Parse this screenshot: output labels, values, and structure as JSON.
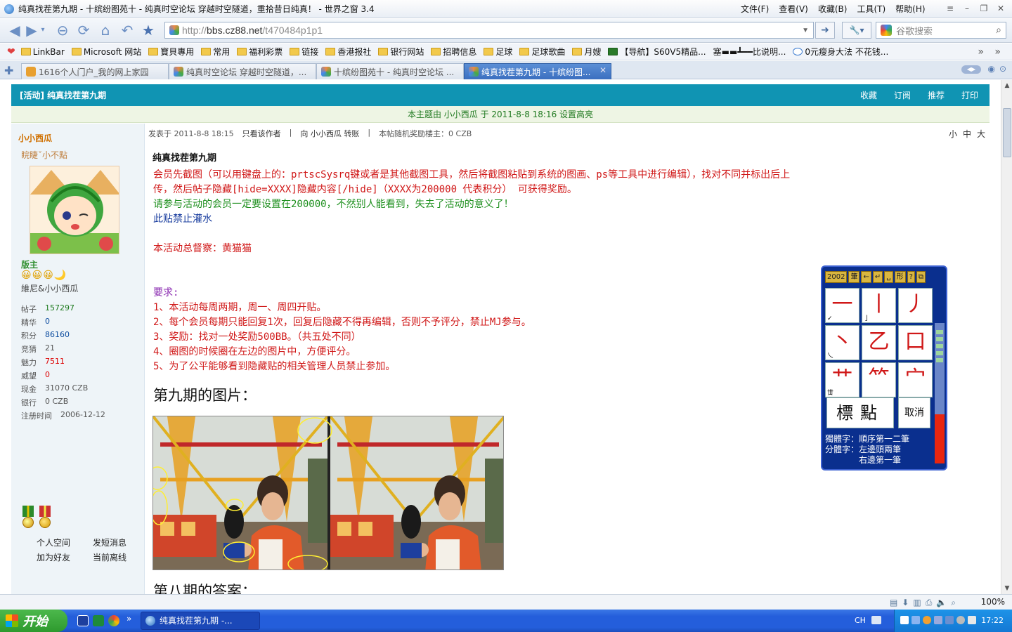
{
  "window": {
    "title": "纯真找茬第九期 - 十缤纷图苑十 - 纯真时空论坛 穿越时空隧道，重拾昔日纯真！ - 世界之窗 3.4",
    "menus": [
      "文件(F)",
      "查看(V)",
      "收藏(B)",
      "工具(T)",
      "帮助(H)"
    ]
  },
  "address": {
    "prefix": "http://",
    "host": "bbs.cz88.net",
    "path": "/t470484p1p1"
  },
  "search": {
    "placeholder": "谷歌搜索"
  },
  "bookmarks": [
    "LinkBar",
    "Microsoft 网站",
    "寶貝專用",
    "常用",
    "福利彩票",
    "链接",
    "香港报社",
    "银行网站",
    "招聘信息",
    "足球",
    "足球歌曲",
    "月嫂",
    "【导航】S60V5精品...",
    "塞▬▬┻━━比说明...",
    "0元瘦身大法 不花钱..."
  ],
  "tabs": [
    "1616个人门户_我的网上家园",
    "纯真时空论坛 穿越时空隧道，...",
    "十缤纷图苑十 - 纯真时空论坛 ...",
    "纯真找茬第九期 - 十缤纷图..."
  ],
  "forum": {
    "header_title": "[活动] 纯真找茬第九期",
    "actions": [
      "收藏",
      "订阅",
      "推荐",
      "打印"
    ],
    "highlight_notice": "本主题由 小小西瓜 于 2011-8-8 18:16 设置高亮"
  },
  "user": {
    "name": "小小西瓜",
    "signature": "睆睫ˇ小不點",
    "rank": "版主",
    "stars": "😀😀😀🌙",
    "group": "維尼&小小西瓜",
    "stats": [
      {
        "label": "帖子",
        "value": "157297"
      },
      {
        "label": "精华",
        "value": "0"
      },
      {
        "label": "积分",
        "value": "86160"
      },
      {
        "label": "竞猜",
        "value": "21"
      },
      {
        "label": "魅力",
        "value": "7511"
      },
      {
        "label": "威望",
        "value": "0"
      },
      {
        "label": "现金",
        "value": "31070 CZB"
      },
      {
        "label": "银行",
        "value": "0 CZB"
      },
      {
        "label": "注册时间",
        "value": "2006-12-12"
      }
    ],
    "links": [
      "个人空间",
      "发短消息",
      "加为好友",
      "当前离线"
    ]
  },
  "post": {
    "meta_posted": "发表于 2011-8-8 18:15",
    "meta_author_only": "只看该作者",
    "meta_transfer": "向 小小西瓜 转账",
    "meta_reward": "本帖随机奖励楼主：0 CZB",
    "font_sizes": [
      "小",
      "中",
      "大"
    ],
    "title": "纯真找茬第九期",
    "lines": {
      "l1": "会员先截图（可以用键盘上的：prtscSysrq键或者是其他截图工具，然后将截图粘贴到系统的图画、ps等工具中进行编辑），找对不同并标出后上",
      "l2": "传，然后帖子隐藏[hide=XXXX]隐藏内容[/hide]（XXXX为200000 代表积分） 可获得奖励。",
      "l3": "请参与活动的会员一定要设置在200000，不然别人能看到，失去了活动的意义了！",
      "l4": "此贴禁止灌水",
      "l5": "本活动总督察：黄猫猫",
      "req": "要求:",
      "r1": "1、本活动每周两期，周一、周四开贴。",
      "r2": "2、每个会员每期只能回复1次，回复后隐藏不得再编辑，否则不予评分，禁止MJ参与。",
      "r3": "3、奖励：找对一处奖励500BB。（共五处不同）",
      "r4": "4、圈图的时候圈在左边的图片中，方便评分。",
      "r5": "5、为了公平能够看到隐藏贴的相关管理人员禁止参加。"
    },
    "section_9": "第九期的图片：",
    "section_8": "第八期的答案："
  },
  "ime": {
    "toolbar": [
      "2002",
      "筆",
      "←",
      "↵",
      "␣",
      "形",
      "?",
      "⧉"
    ],
    "strokes": [
      {
        "char": "一",
        "sub": "✓"
      },
      {
        "char": "丨",
        "sub": "亅"
      },
      {
        "char": "丿",
        "sub": ""
      },
      {
        "char": "丶",
        "sub": "乀"
      },
      {
        "char": "乙",
        "sub": ""
      },
      {
        "char": "口",
        "sub": ""
      },
      {
        "char": "艹",
        "sub": "丗"
      },
      {
        "char": "⺮",
        "sub": ""
      },
      {
        "char": "宀",
        "sub": ""
      }
    ],
    "punct": "標點",
    "cancel": "取消",
    "help": [
      "獨體字：順序第一二筆",
      "分體字：左邊頭兩筆",
      "　　　　右邊第一筆"
    ]
  },
  "status": {
    "zoom": "100%"
  },
  "taskbar": {
    "start": "开始",
    "task": "纯真找茬第九期 -...",
    "lang": "CH",
    "clock": "17:22"
  },
  "colors": {
    "forum_header": "#1094b3",
    "post_red": "#d01818",
    "post_green": "#1d8f1d",
    "taskbar": "#245edb"
  }
}
